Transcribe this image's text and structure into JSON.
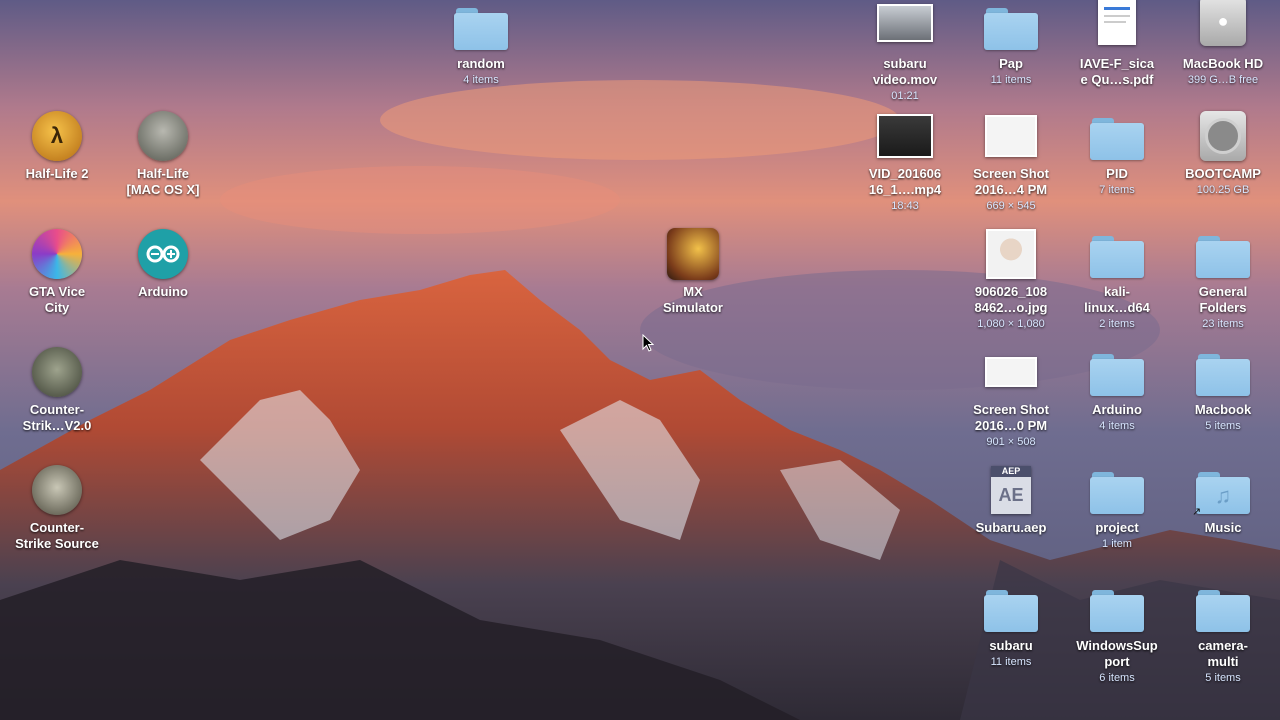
{
  "desktop": {
    "icons": [
      {
        "name": "random",
        "meta": "4 items",
        "kind": "folder-icon"
      },
      {
        "name": "Half-Life 2",
        "meta": "",
        "kind": "app-icon"
      },
      {
        "name": "Half-Life\n[MAC OS X]",
        "meta": "",
        "kind": "app-icon"
      },
      {
        "name": "GTA Vice\nCity",
        "meta": "",
        "kind": "app-icon"
      },
      {
        "name": "Arduino",
        "meta": "",
        "kind": "app-icon"
      },
      {
        "name": "MX\nSimulator",
        "meta": "",
        "kind": "app-icon"
      },
      {
        "name": "Counter-\nStrik…V2.0",
        "meta": "",
        "kind": "app-icon"
      },
      {
        "name": "Counter-\nStrike Source",
        "meta": "",
        "kind": "app-icon"
      },
      {
        "name": "subaru\nvideo.mov",
        "meta": "01:21",
        "kind": "video-icon"
      },
      {
        "name": "Pap",
        "meta": "11 items",
        "kind": "folder-icon"
      },
      {
        "name": "IAVE-F_sica\ne Qu…s.pdf",
        "meta": "",
        "kind": "pdf-icon"
      },
      {
        "name": "MacBook HD",
        "meta": "399 G…B free",
        "kind": "drive-icon"
      },
      {
        "name": "VID_201606\n16_1….mp4",
        "meta": "18:43",
        "kind": "video-icon"
      },
      {
        "name": "Screen Shot\n2016…4 PM",
        "meta": "669 × 545",
        "kind": "image-icon"
      },
      {
        "name": "PID",
        "meta": "7 items",
        "kind": "folder-icon"
      },
      {
        "name": "BOOTCAMP",
        "meta": "100.25 GB",
        "kind": "drive-icon"
      },
      {
        "name": "906026_108\n8462…o.jpg",
        "meta": "1,080 × 1,080",
        "kind": "image-icon"
      },
      {
        "name": "kali-\nlinux…d64",
        "meta": "2 items",
        "kind": "folder-icon"
      },
      {
        "name": "General\nFolders",
        "meta": "23 items",
        "kind": "folder-icon"
      },
      {
        "name": "Screen Shot\n2016…0 PM",
        "meta": "901 × 508",
        "kind": "image-icon"
      },
      {
        "name": "Arduino",
        "meta": "4 items",
        "kind": "folder-icon"
      },
      {
        "name": "Macbook",
        "meta": "5 items",
        "kind": "folder-icon"
      },
      {
        "name": "Subaru.aep",
        "meta": "",
        "kind": "aep-icon"
      },
      {
        "name": "project",
        "meta": "1 item",
        "kind": "folder-icon"
      },
      {
        "name": "Music",
        "meta": "",
        "kind": "folder-alias-icon"
      },
      {
        "name": "subaru",
        "meta": "11 items",
        "kind": "folder-icon"
      },
      {
        "name": "WindowsSup\nport",
        "meta": "6 items",
        "kind": "folder-icon"
      },
      {
        "name": "camera-\nmulti",
        "meta": "5 items",
        "kind": "folder-icon"
      }
    ],
    "aep_badge": "AEP",
    "aep_letters": "AE"
  }
}
